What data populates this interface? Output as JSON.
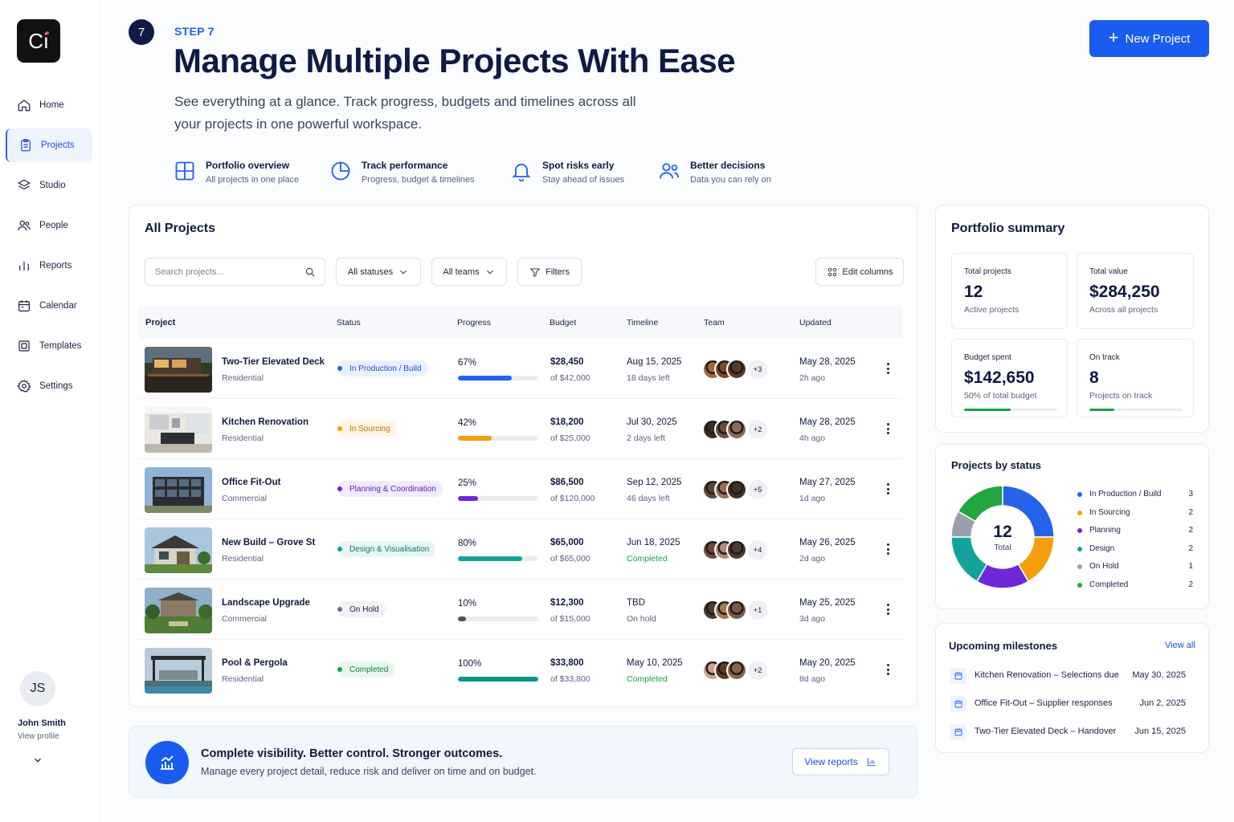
{
  "app": {
    "logo_text": "Ci"
  },
  "sidebar": {
    "items": [
      {
        "label": "Home",
        "icon": "home-icon"
      },
      {
        "label": "Projects",
        "icon": "clipboard-icon",
        "active": true
      },
      {
        "label": "Studio",
        "icon": "layers-icon"
      },
      {
        "label": "People",
        "icon": "people-icon"
      },
      {
        "label": "Reports",
        "icon": "bar-chart-icon"
      },
      {
        "label": "Calendar",
        "icon": "calendar-icon"
      },
      {
        "label": "Templates",
        "icon": "templates-icon"
      },
      {
        "label": "Settings",
        "icon": "gear-icon"
      }
    ],
    "profile": {
      "initials": "JS",
      "name": "John Smith",
      "sub": "View profile"
    }
  },
  "header": {
    "step_number": "7",
    "step_label": "STEP 7",
    "title": "Manage Multiple Projects With Ease",
    "subtitle": "See everything at a glance. Track progress, budgets and timelines across all your projects in one powerful workspace.",
    "new_project_label": "New Project"
  },
  "features": [
    {
      "title": "Portfolio overview",
      "sub": "All projects in one place",
      "icon": "grid-icon"
    },
    {
      "title": "Track performance",
      "sub": "Progress, budget & timelines",
      "icon": "pie-icon"
    },
    {
      "title": "Spot risks early",
      "sub": "Stay ahead of issues",
      "icon": "bell-icon"
    },
    {
      "title": "Better decisions",
      "sub": "Data you can rely on",
      "icon": "users-icon"
    }
  ],
  "projects": {
    "title": "All Projects",
    "search_placeholder": "Search projects...",
    "filter_status": "All statuses",
    "filter_teams": "All teams",
    "filters_label": "Filters",
    "edit_columns_label": "Edit columns",
    "columns": [
      "Project",
      "Status",
      "Progress",
      "Budget",
      "Timeline",
      "Team",
      "Updated"
    ],
    "rows": [
      {
        "name": "Two-Tier Elevated Deck",
        "type": "Residential",
        "status": "In Production / Build",
        "status_color": "#2563eb",
        "status_bg": "#eaf1fe",
        "status_text": "#1d4ed8",
        "progress_label": "67%",
        "progress": 0.67,
        "bar_color": "#2563eb",
        "budget": "$28,450",
        "budget_of": "of $42,000",
        "timeline": "Aug 15, 2025",
        "timeline_sub": "18 days left",
        "timeline_done": false,
        "team_more": "+3",
        "updated": "May 28, 2025",
        "updated_sub": "2h ago"
      },
      {
        "name": "Kitchen Renovation",
        "type": "Residential",
        "status": "In Sourcing",
        "status_color": "#f59e0b",
        "status_bg": "#fff4e2",
        "status_text": "#c2710c",
        "progress_label": "42%",
        "progress": 0.42,
        "bar_color": "#f59e0b",
        "budget": "$18,200",
        "budget_of": "of $25,000",
        "timeline": "Jul 30, 2025",
        "timeline_sub": "2 days left",
        "timeline_done": false,
        "team_more": "+2",
        "updated": "May 28, 2025",
        "updated_sub": "4h ago"
      },
      {
        "name": "Office Fit-Out",
        "type": "Commercial",
        "status": "Planning & Coordination",
        "status_color": "#6d28d9",
        "status_bg": "#f0ebfd",
        "status_text": "#5b21b6",
        "progress_label": "25%",
        "progress": 0.25,
        "bar_color": "#6d28d9",
        "budget": "$86,500",
        "budget_of": "of $120,000",
        "timeline": "Sep 12, 2025",
        "timeline_sub": "46 days left",
        "timeline_done": false,
        "team_more": "+5",
        "updated": "May 27, 2025",
        "updated_sub": "1d ago"
      },
      {
        "name": "New Build – Grove St",
        "type": "Residential",
        "status": "Design & Visualisation",
        "status_color": "#14a39a",
        "status_bg": "#e5f6f4",
        "status_text": "#0f766e",
        "progress_label": "80%",
        "progress": 0.8,
        "bar_color": "#14a39a",
        "budget": "$65,000",
        "budget_of": "of $65,000",
        "timeline": "Jun 18, 2025",
        "timeline_sub": "Completed",
        "timeline_done": true,
        "team_more": "+4",
        "updated": "May 26, 2025",
        "updated_sub": "2d ago"
      },
      {
        "name": "Landscape Upgrade",
        "type": "Commercial",
        "status": "On Hold",
        "status_color": "#6b7280",
        "status_bg": "#f1f2f5",
        "status_text": "#1b2240",
        "progress_label": "10%",
        "progress": 0.1,
        "bar_color": "#4b5563",
        "budget": "$12,300",
        "budget_of": "of $15,000",
        "timeline": "TBD",
        "timeline_sub": "On hold",
        "timeline_done": false,
        "team_more": "+1",
        "updated": "May 25, 2025",
        "updated_sub": "3d ago"
      },
      {
        "name": "Pool & Pergola",
        "type": "Residential",
        "status": "Completed",
        "status_color": "#16a34a",
        "status_bg": "#e8f7ec",
        "status_text": "#15803d",
        "progress_label": "100%",
        "progress": 1.0,
        "bar_color": "#0f9488",
        "budget": "$33,800",
        "budget_of": "of $33,800",
        "timeline": "May 10, 2025",
        "timeline_sub": "Completed",
        "timeline_done": true,
        "team_more": "+2",
        "updated": "May 20, 2025",
        "updated_sub": "8d ago"
      }
    ]
  },
  "banner": {
    "title": "Complete visibility. Better control. Stronger outcomes.",
    "sub": "Manage every project detail, reduce risk and deliver on time and on budget.",
    "button_label": "View reports"
  },
  "summary": {
    "title": "Portfolio summary",
    "stats": [
      {
        "label": "Total projects",
        "value": "12",
        "sub": "Active projects"
      },
      {
        "label": "Total value",
        "value": "$284,250",
        "sub": "Across all projects"
      },
      {
        "label": "Budget spent",
        "value": "$142,650",
        "sub": "50% of total budget",
        "progress": 0.5
      },
      {
        "label": "On track",
        "value": "8",
        "sub": "Projects on track",
        "progress": 0.27
      }
    ]
  },
  "by_status": {
    "title": "Projects by status",
    "total": "12",
    "total_label": "Total",
    "items": [
      {
        "label": "In Production / Build",
        "value": 3,
        "color": "#2563eb"
      },
      {
        "label": "In Sourcing",
        "value": 2,
        "color": "#f59e0b"
      },
      {
        "label": "Planning",
        "value": 2,
        "color": "#6d28d9"
      },
      {
        "label": "Design",
        "value": 2,
        "color": "#14a39a"
      },
      {
        "label": "On Hold",
        "value": 1,
        "color": "#9aa0ab"
      },
      {
        "label": "Completed",
        "value": 2,
        "color": "#22a63e"
      }
    ]
  },
  "milestones": {
    "title": "Upcoming milestones",
    "view_all": "View all",
    "items": [
      {
        "title": "Kitchen Renovation – Selections due",
        "date": "May 30, 2025"
      },
      {
        "title": "Office Fit-Out – Supplier responses",
        "date": "Jun 2, 2025"
      },
      {
        "title": "Two-Tier Elevated Deck – Handover",
        "date": "Jun 15, 2025"
      }
    ]
  }
}
